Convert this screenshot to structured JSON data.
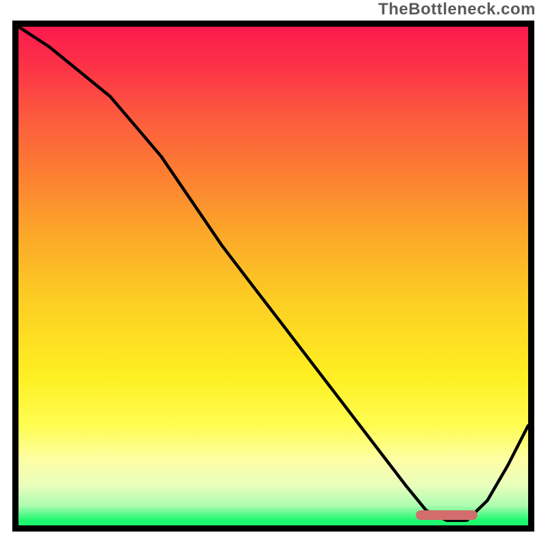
{
  "watermark": "TheBottleneck.com",
  "chart_data": {
    "type": "line",
    "title": "",
    "xlabel": "",
    "ylabel": "",
    "xlim": [
      0,
      100
    ],
    "ylim": [
      0,
      100
    ],
    "series": [
      {
        "name": "bottleneck-curve",
        "x": [
          0,
          6,
          12,
          18,
          23,
          28,
          34,
          40,
          46,
          52,
          58,
          64,
          70,
          76,
          80,
          84,
          88,
          92,
          96,
          100
        ],
        "values": [
          100,
          96,
          91,
          86,
          80,
          74,
          65,
          56,
          48,
          40,
          32,
          24,
          16,
          8,
          3,
          1,
          1,
          5,
          12,
          20
        ]
      }
    ],
    "annotations": {
      "optimal_range_x": [
        78,
        90
      ],
      "optimal_range_y": 2
    },
    "background_gradient": {
      "top": "#fc1a4e",
      "mid": "#fdce23",
      "bottom": "#1ef870"
    }
  }
}
